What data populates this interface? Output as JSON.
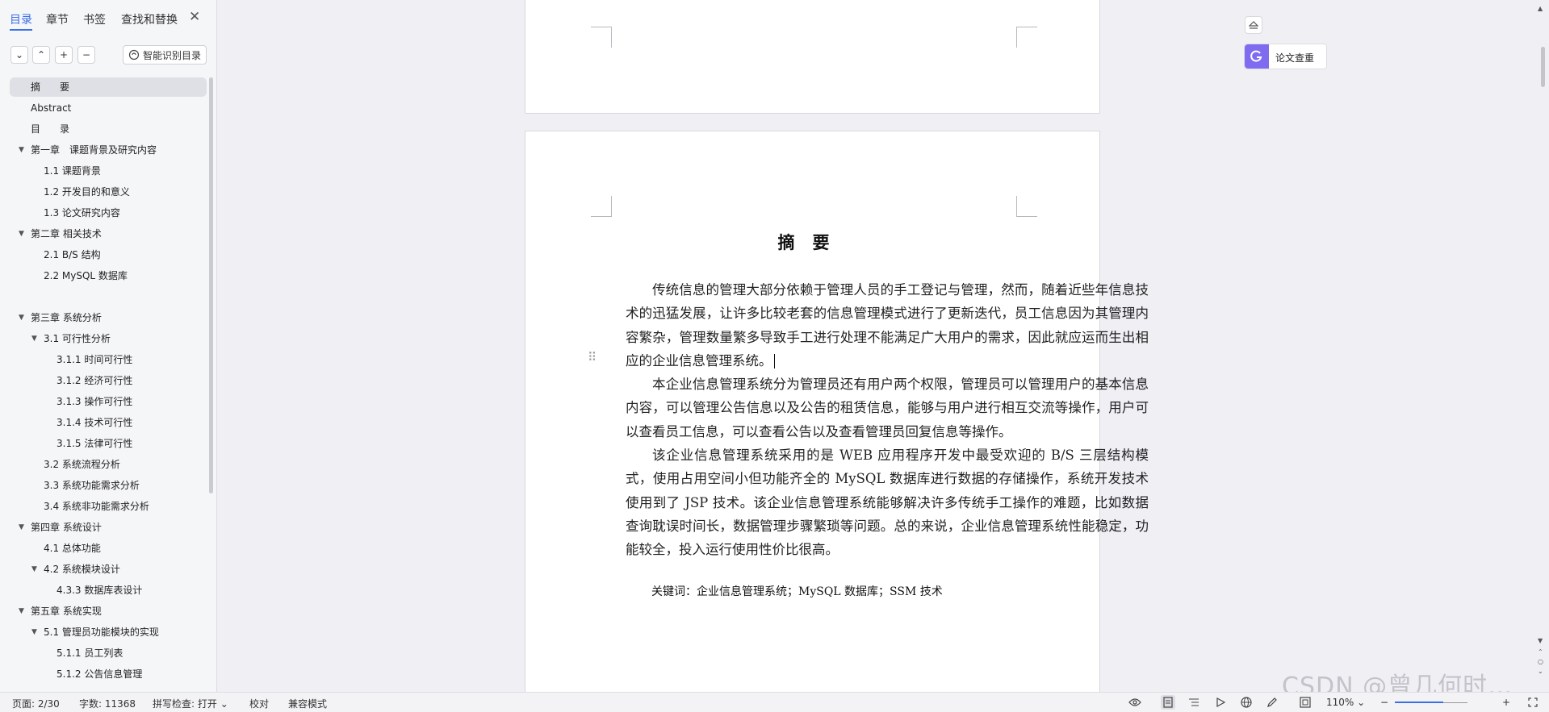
{
  "sidebar": {
    "tabs": [
      {
        "label": "目录",
        "active": true
      },
      {
        "label": "章节",
        "active": false
      },
      {
        "label": "书签",
        "active": false
      },
      {
        "label": "查找和替换",
        "active": false
      }
    ],
    "smart_button": "智能识别目录",
    "toc": [
      {
        "label": "摘　　要",
        "level": 0,
        "selected": true
      },
      {
        "label": "Abstract",
        "level": 0
      },
      {
        "label": "目　　录",
        "level": 0
      },
      {
        "label": "第一章　课题背景及研究内容",
        "level": 0,
        "expanded": true
      },
      {
        "label": "1.1  课题背景",
        "level": 1
      },
      {
        "label": "1.2  开发目的和意义",
        "level": 1
      },
      {
        "label": "1.3  论文研究内容",
        "level": 1
      },
      {
        "label": "第二章  相关技术",
        "level": 0,
        "expanded": true
      },
      {
        "label": "2.1 B/S 结构",
        "level": 1
      },
      {
        "label": "2.2 MySQL 数据库",
        "level": 1
      },
      {
        "label": "第三章  系统分析",
        "level": 0,
        "expanded": true
      },
      {
        "label": "3.1 可行性分析",
        "level": 1,
        "expanded": true
      },
      {
        "label": "3.1.1 时间可行性",
        "level": 2
      },
      {
        "label": "3.1.2  经济可行性",
        "level": 2
      },
      {
        "label": "3.1.3  操作可行性",
        "level": 2
      },
      {
        "label": "3.1.4  技术可行性",
        "level": 2
      },
      {
        "label": "3.1.5  法律可行性",
        "level": 2
      },
      {
        "label": "3.2 系统流程分析",
        "level": 1
      },
      {
        "label": "3.3 系统功能需求分析",
        "level": 1
      },
      {
        "label": "3.4  系统非功能需求分析",
        "level": 1
      },
      {
        "label": "第四章  系统设计",
        "level": 0,
        "expanded": true
      },
      {
        "label": "4.1  总体功能",
        "level": 1
      },
      {
        "label": "4.2  系统模块设计",
        "level": 1,
        "expanded": true
      },
      {
        "label": "4.3.3  数据库表设计",
        "level": 2
      },
      {
        "label": "第五章  系统实现",
        "level": 0,
        "expanded": true
      },
      {
        "label": "5.1  管理员功能模块的实现",
        "level": 1,
        "expanded": true
      },
      {
        "label": "5.1.1  员工列表",
        "level": 2
      },
      {
        "label": "5.1.2  公告信息管理",
        "level": 2
      }
    ]
  },
  "document": {
    "title": "摘要",
    "paragraphs": [
      "传统信息的管理大部分依赖于管理人员的手工登记与管理，然而，随着近些年信息技术的迅猛发展，让许多比较老套的信息管理模式进行了更新迭代，员工信息因为其管理内容繁杂，管理数量繁多导致手工进行处理不能满足广大用户的需求，因此就应运而生出相应的企业信息管理系统。",
      "本企业信息管理系统分为管理员还有用户两个权限，管理员可以管理用户的基本信息内容，可以管理公告信息以及公告的租赁信息，能够与用户进行相互交流等操作，用户可以查看员工信息，可以查看公告以及查看管理员回复信息等操作。",
      "该企业信息管理系统采用的是 WEB 应用程序开发中最受欢迎的 B/S 三层结构模式，使用占用空间小但功能齐全的 MySQL 数据库进行数据的存储操作，系统开发技术使用到了 JSP 技术。该企业信息管理系统能够解决许多传统手工操作的难题，比如数据查询耽误时间长，数据管理步骤繁琐等问题。总的来说，企业信息管理系统性能稳定，功能较全，投入运行使用性价比很高。"
    ],
    "keywords": "关键词：企业信息管理系统；MySQL 数据库；SSM 技术"
  },
  "right_panel": {
    "plagiarism_button": "论文查重"
  },
  "statusbar": {
    "page": "页面: 2/30",
    "words": "字数: 11368",
    "spellcheck": "拼写检查: 打开",
    "proof": "校对",
    "compat": "兼容模式",
    "zoom": "110%"
  },
  "watermark": "CSDN @曾几何时…",
  "colors": {
    "accent": "#3c6ee8",
    "plagiarism": "#7f6bf0"
  }
}
